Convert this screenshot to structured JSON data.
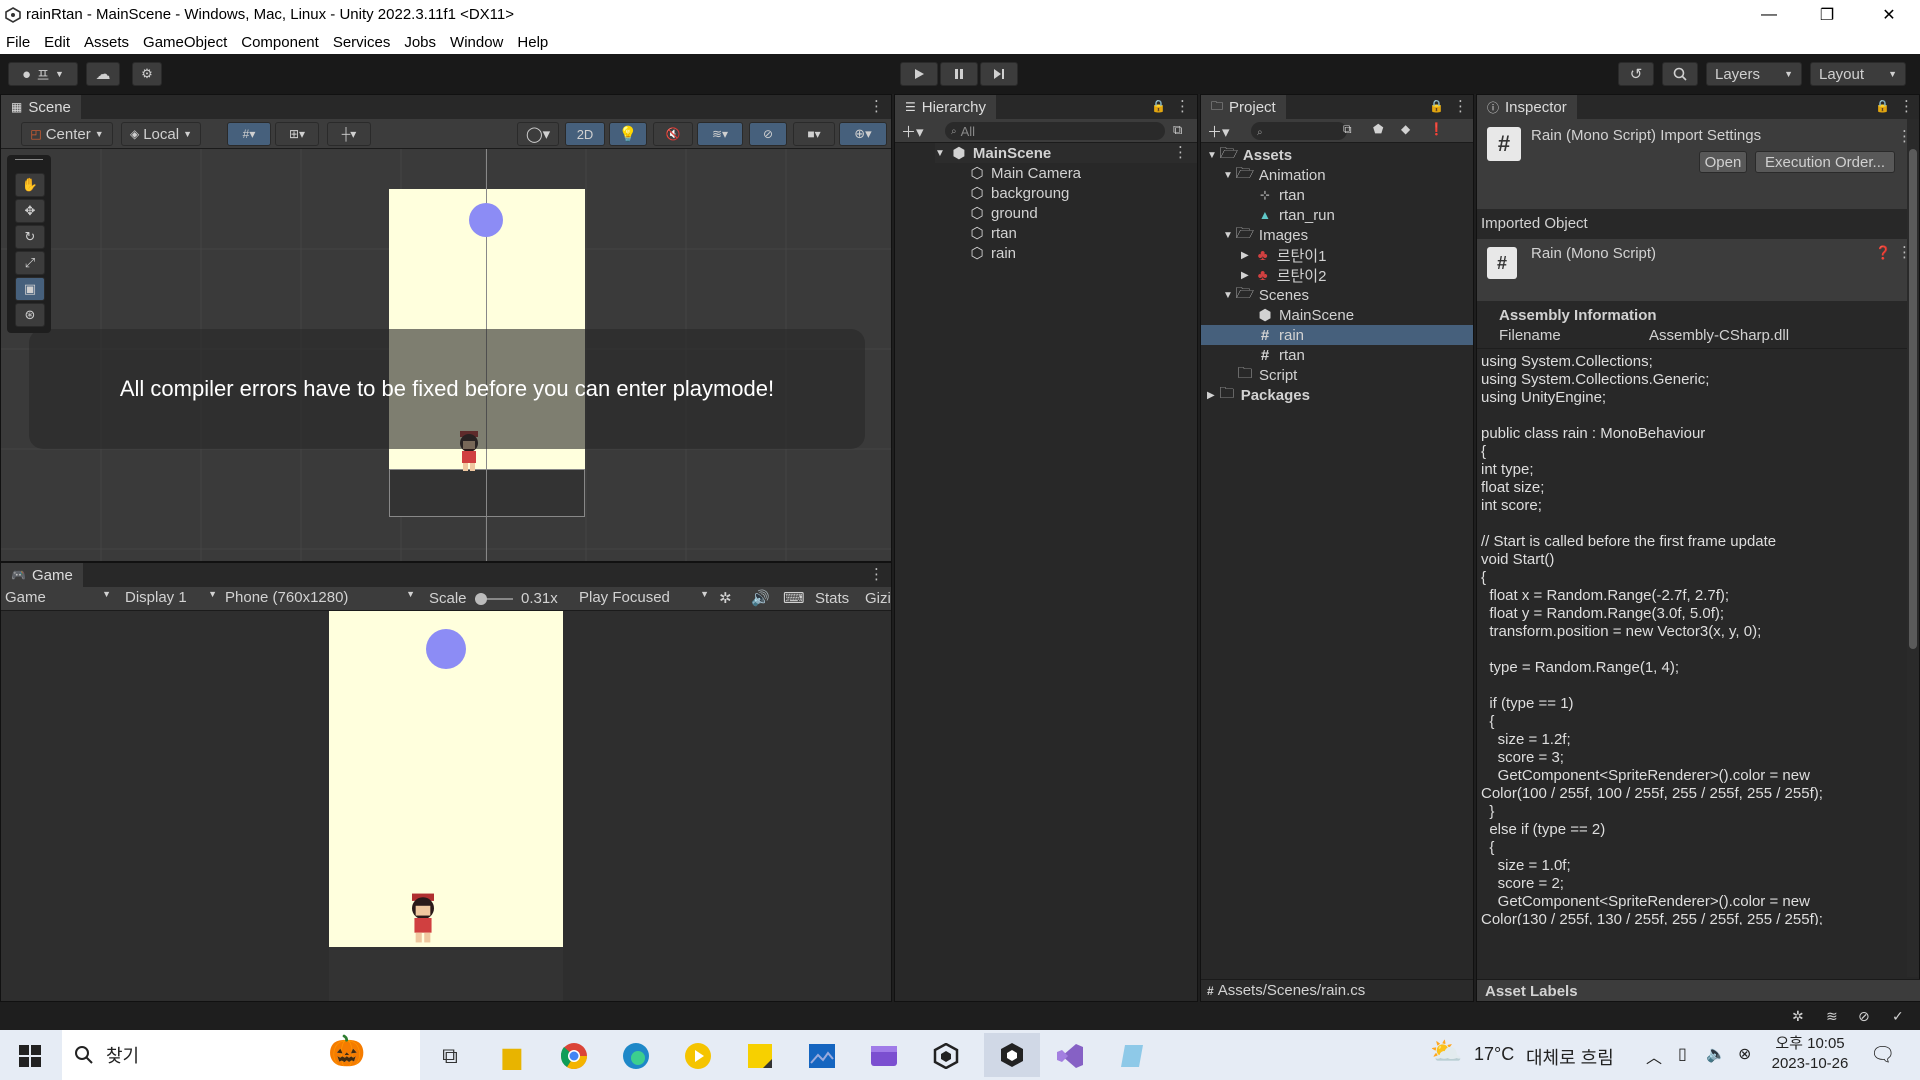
{
  "window": {
    "title": "rainRtan - MainScene - Windows, Mac, Linux - Unity 2022.3.11f1 <DX11>"
  },
  "menu": [
    "File",
    "Edit",
    "Assets",
    "GameObject",
    "Component",
    "Services",
    "Jobs",
    "Window",
    "Help"
  ],
  "toolbar": {
    "layers_label": "Layers",
    "layout_label": "Layout",
    "account_label": "프"
  },
  "scene": {
    "tab_label": "Scene",
    "pivot_label": "Center",
    "space_label": "Local",
    "mode_2d_label": "2D",
    "compile_error": "All compiler errors have to be fixed before you can enter playmode!"
  },
  "game": {
    "tab_label": "Game",
    "view_select": "Game",
    "display_select": "Display 1",
    "resolution_select": "Phone (760x1280)",
    "scale_label": "Scale",
    "scale_value": "0.31x",
    "play_mode_select": "Play Focused",
    "stats_label": "Stats",
    "gizmos_label": "Gizi"
  },
  "hierarchy": {
    "tab_label": "Hierarchy",
    "search_placeholder": "All",
    "scene_name": "MainScene",
    "items": [
      "Main Camera",
      "backgroung",
      "ground",
      "rtan",
      "rain"
    ]
  },
  "project": {
    "tab_label": "Project",
    "tree": {
      "assets": "Assets",
      "animation": "Animation",
      "anim_items": [
        "rtan",
        "rtan_run"
      ],
      "images": "Images",
      "image_items": [
        "르탄이1",
        "르탄이2"
      ],
      "scenes": "Scenes",
      "scene_items": [
        "MainScene",
        "rain",
        "rtan"
      ],
      "script": "Script",
      "packages": "Packages"
    },
    "footer_path": "Assets/Scenes/rain.cs"
  },
  "inspector": {
    "tab_label": "Inspector",
    "header_title": "Rain (Mono Script) Import Settings",
    "open_button": "Open",
    "execution_order_button": "Execution Order...",
    "imported_object_label": "Imported Object",
    "object_title": "Rain (Mono Script)",
    "assembly_info_label": "Assembly Information",
    "filename_label": "Filename",
    "filename_value": "Assembly-CSharp.dll",
    "code_lines": [
      "using System.Collections;",
      "using System.Collections.Generic;",
      "using UnityEngine;",
      "",
      "public class rain : MonoBehaviour",
      "{",
      "int type;",
      "float size;",
      "int score;",
      "",
      "// Start is called before the first frame update",
      "void Start()",
      "{",
      "  float x = Random.Range(-2.7f, 2.7f);",
      "  float y = Random.Range(3.0f, 5.0f);",
      "  transform.position = new Vector3(x, y, 0);",
      "",
      "  type = Random.Range(1, 4);",
      "",
      "  if (type == 1)",
      "  {",
      "    size = 1.2f;",
      "    score = 3;",
      "    GetComponent<SpriteRenderer>().color = new",
      "Color(100 / 255f, 100 / 255f, 255 / 255f, 255 / 255f);",
      "  }",
      "  else if (type == 2)",
      "  {",
      "    size = 1.0f;",
      "    score = 2;",
      "    GetComponent<SpriteRenderer>().color = new",
      "Color(130 / 255f, 130 / 255f, 255 / 255f, 255 / 255f);"
    ],
    "asset_labels": "Asset Labels"
  },
  "taskbar": {
    "search_placeholder": "찾기",
    "weather_temp": "17°C",
    "weather_text": "대체로 흐림",
    "ime_label": "오후",
    "time": "10:05",
    "date": "2023-10-26"
  },
  "colors": {
    "accent": "#46607c",
    "scene_bg": "#3a3a3a",
    "game_bg": "#ffffdd",
    "rain_drop": "#8c8cf5"
  }
}
